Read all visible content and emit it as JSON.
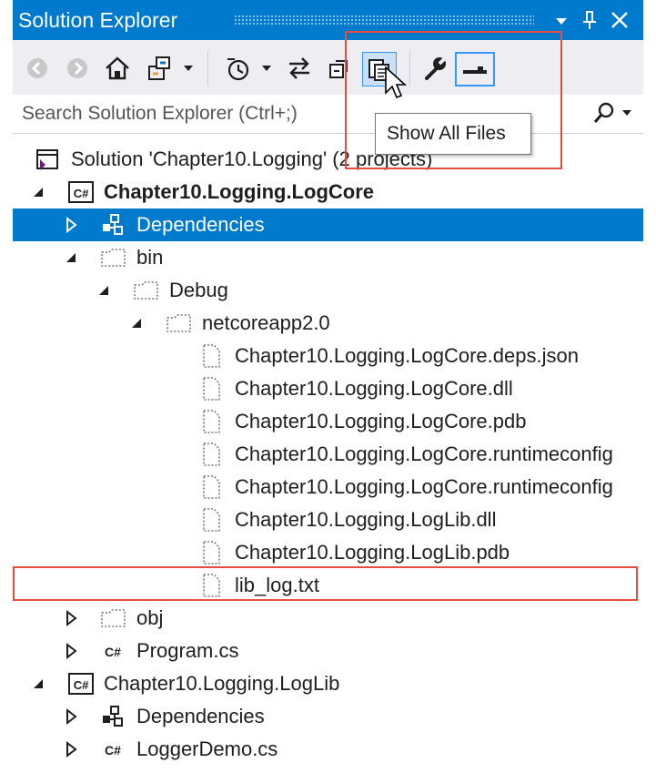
{
  "window": {
    "title": "Solution Explorer"
  },
  "search": {
    "placeholder": "Search Solution Explorer (Ctrl+;)"
  },
  "tooltip": {
    "text": "Show All Files"
  },
  "colors": {
    "accent": "#007acc",
    "highlight": "#e74c3c",
    "toolbar_bg": "#eeeef2"
  },
  "toolbar": {
    "buttons": [
      "back-icon",
      "forward-icon",
      "home-icon",
      "switch-views-icon",
      "pending-changes-filter-icon",
      "sync-icon",
      "collapse-all-icon",
      "show-all-files-icon",
      "properties-icon",
      "preview-selected-items-icon"
    ]
  },
  "tree": [
    {
      "label": "Solution 'Chapter10.Logging' (2 projects)",
      "icon": "solution-icon",
      "expander": "none"
    },
    {
      "label": "Chapter10.Logging.LogCore",
      "icon": "csharp-project-icon",
      "expander": "expanded",
      "bold": true
    },
    {
      "label": "Dependencies",
      "icon": "dependencies-icon",
      "expander": "collapsed",
      "selected": true
    },
    {
      "label": "bin",
      "icon": "excluded-folder-icon",
      "expander": "expanded"
    },
    {
      "label": "Debug",
      "icon": "excluded-folder-icon",
      "expander": "expanded"
    },
    {
      "label": "netcoreapp2.0",
      "icon": "excluded-folder-icon",
      "expander": "expanded"
    },
    {
      "label": "Chapter10.Logging.LogCore.deps.json",
      "icon": "excluded-file-icon",
      "expander": "none"
    },
    {
      "label": "Chapter10.Logging.LogCore.dll",
      "icon": "excluded-file-icon",
      "expander": "none"
    },
    {
      "label": "Chapter10.Logging.LogCore.pdb",
      "icon": "excluded-file-icon",
      "expander": "none"
    },
    {
      "label": "Chapter10.Logging.LogCore.runtimeconfig",
      "icon": "excluded-file-icon",
      "expander": "none"
    },
    {
      "label": "Chapter10.Logging.LogCore.runtimeconfig",
      "icon": "excluded-file-icon",
      "expander": "none"
    },
    {
      "label": "Chapter10.Logging.LogLib.dll",
      "icon": "excluded-file-icon",
      "expander": "none"
    },
    {
      "label": "Chapter10.Logging.LogLib.pdb",
      "icon": "excluded-file-icon",
      "expander": "none"
    },
    {
      "label": "lib_log.txt",
      "icon": "excluded-file-icon",
      "expander": "none"
    },
    {
      "label": "obj",
      "icon": "excluded-folder-icon",
      "expander": "collapsed"
    },
    {
      "label": "Program.cs",
      "icon": "csharp-file-icon",
      "expander": "collapsed"
    },
    {
      "label": "Chapter10.Logging.LogLib",
      "icon": "csharp-project-icon",
      "expander": "expanded"
    },
    {
      "label": "Dependencies",
      "icon": "dependencies-icon",
      "expander": "collapsed"
    },
    {
      "label": "LoggerDemo.cs",
      "icon": "csharp-file-icon",
      "expander": "collapsed"
    }
  ]
}
